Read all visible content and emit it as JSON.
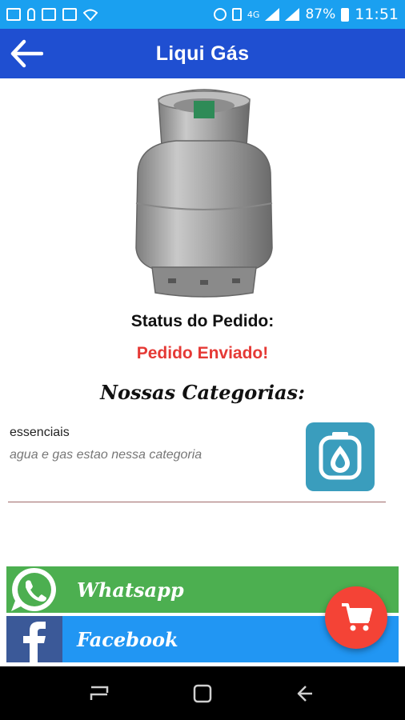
{
  "status_bar": {
    "network": "4G",
    "battery": "87%",
    "time": "11:51"
  },
  "app_bar": {
    "title": "Liqui Gás"
  },
  "order": {
    "status_label": "Status do Pedido:",
    "status_value": "Pedido Enviado!"
  },
  "categories": {
    "heading": "Nossas Categorias:",
    "items": [
      {
        "name": "essenciais",
        "description": "agua e gas estao nessa categoria"
      }
    ]
  },
  "social": {
    "whatsapp_label": "Whatsapp",
    "facebook_label": "Facebook"
  },
  "colors": {
    "status_bar": "#1aa0f0",
    "app_bar": "#1f4fd1",
    "status_value": "#e53935",
    "category_icon_bg": "#3a9dbd",
    "whatsapp": "#4caf50",
    "facebook": "#2196f3",
    "facebook_logo": "#3b5998",
    "fab": "#f44336"
  },
  "icons": {
    "back": "arrow-left-icon",
    "category": "gas-drop-icon",
    "fab": "shopping-cart-icon",
    "whatsapp": "whatsapp-icon",
    "facebook": "facebook-icon"
  }
}
